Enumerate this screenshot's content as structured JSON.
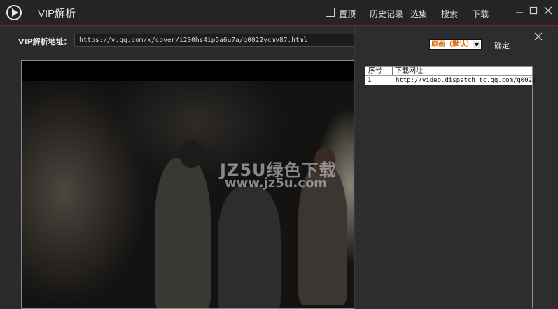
{
  "app": {
    "title": "VIP解析"
  },
  "topbar": {
    "pin_label": "置顶",
    "history_label": "历史记录",
    "episodes_label": "选集",
    "search_label": "搜索",
    "download_label": "下载"
  },
  "url_bar": {
    "label": "VIP解析地址：",
    "value": "https://v.qq.com/x/cover/i200hs4ip5a6u7a/q0022ycmv87.html"
  },
  "watermark": {
    "line1": "JZ5U绿色下载",
    "line2": "www.jz5u.com"
  },
  "download_panel": {
    "quality_selected": "原画（默认）",
    "confirm_label": "确定",
    "columns": [
      "序号",
      "下载网址"
    ],
    "rows": [
      {
        "index": "1",
        "url": "http://video.dispatch.tc.qq.com/q0022..."
      }
    ]
  },
  "colors": {
    "accent_line": "#8a1d1d",
    "select_text": "#e06a00"
  }
}
